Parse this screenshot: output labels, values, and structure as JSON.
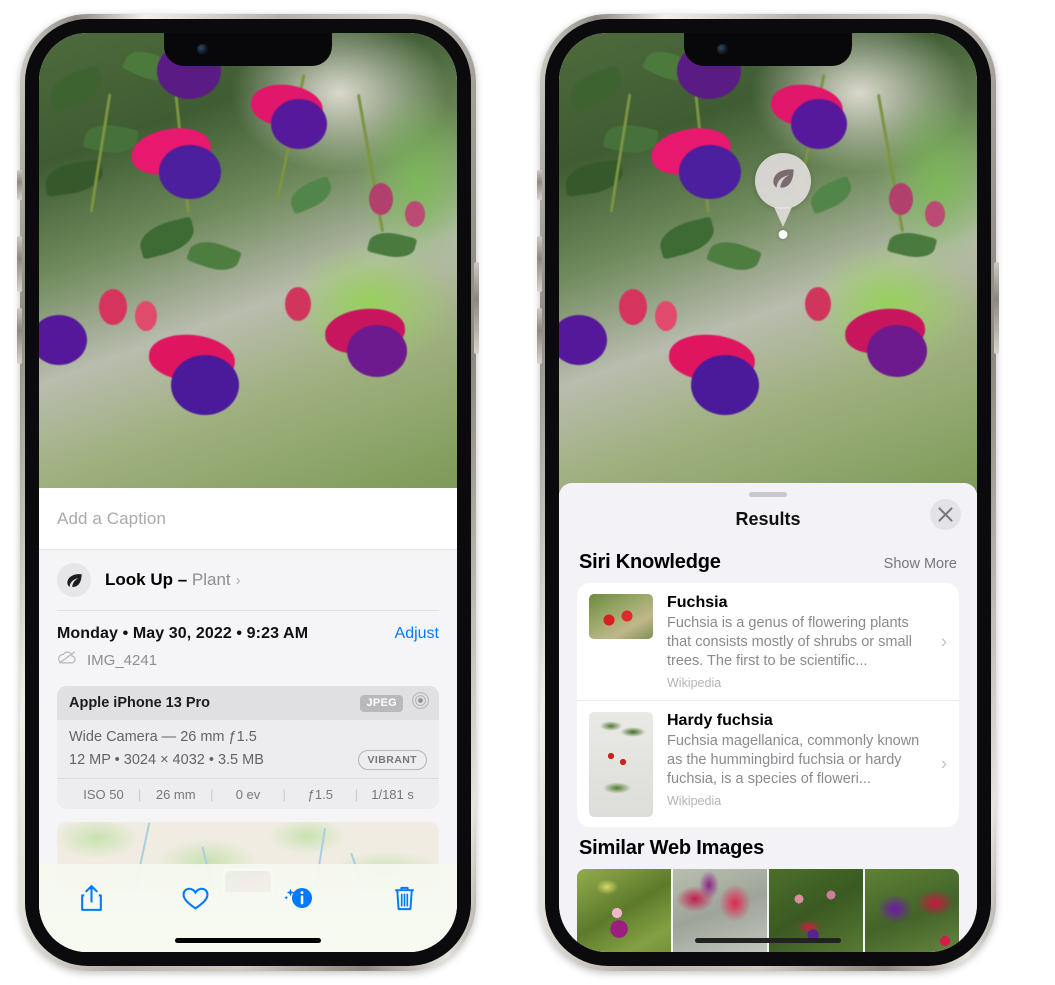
{
  "left_phone": {
    "photo_alt": "fuchsia-flowers-photo",
    "caption": {
      "placeholder": "Add a Caption",
      "value": ""
    },
    "lookup": {
      "label": "Look Up –",
      "subject": "Plant",
      "icon": "leaf-icon",
      "chevron": "›"
    },
    "meta": {
      "date": "Monday • May 30, 2022 • 9:23 AM",
      "adjust_label": "Adjust",
      "filename": "IMG_4241",
      "cloud_icon": "cloud-slash-icon"
    },
    "exif": {
      "device": "Apple iPhone 13 Pro",
      "format_badge": "JPEG",
      "aperture_icon": "aperture-icon",
      "lens_line": "Wide Camera — 26 mm ƒ1.5",
      "specs_line": "12 MP • 3024 × 4032 • 3.5 MB",
      "style_badge": "VIBRANT",
      "stats": [
        "ISO 50",
        "26 mm",
        "0 ev",
        "ƒ1.5",
        "1/181 s"
      ]
    },
    "toolbar": [
      {
        "name": "share-button",
        "icon": "share-icon"
      },
      {
        "name": "favorite-button",
        "icon": "heart-icon"
      },
      {
        "name": "info-button",
        "icon": "info-sparkle-icon"
      },
      {
        "name": "delete-button",
        "icon": "trash-icon"
      }
    ]
  },
  "right_phone": {
    "badge": {
      "icon": "leaf-icon"
    },
    "sheet": {
      "title": "Results",
      "close_icon": "close-icon",
      "sections": [
        {
          "title": "Siri Knowledge",
          "action": "Show More",
          "items": [
            {
              "title": "Fuchsia",
              "description": "Fuchsia is a genus of flowering plants that consists mostly of shrubs or small trees. The first to be scientific...",
              "source": "Wikipedia",
              "chevron": "›"
            },
            {
              "title": "Hardy fuchsia",
              "description": "Fuchsia magellanica, commonly known as the hummingbird fuchsia or hardy fuchsia, is a species of floweri...",
              "source": "Wikipedia",
              "chevron": "›"
            }
          ]
        },
        {
          "title": "Similar Web Images",
          "action": "",
          "images": [
            "web-image-1",
            "web-image-2",
            "web-image-3",
            "web-image-4"
          ]
        }
      ]
    }
  },
  "colors": {
    "accent_blue": "#007aff",
    "sheet_bg": "#f2f2f7",
    "card_bg": "#ffffff",
    "secondary_text": "#8a8a8f"
  }
}
